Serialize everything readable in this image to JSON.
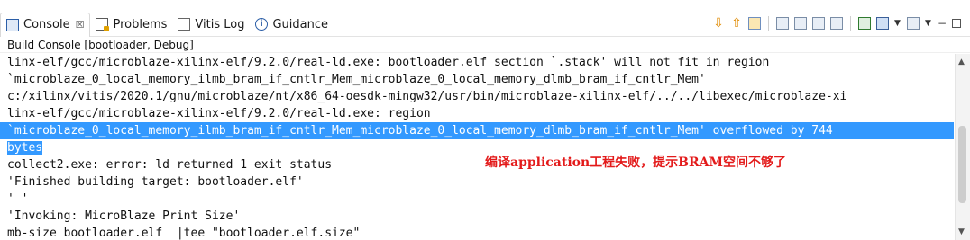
{
  "tabs": [
    {
      "label": "Console",
      "close": "☒",
      "icon": "console-icon"
    },
    {
      "label": "Problems",
      "icon": "problems-icon"
    },
    {
      "label": "Vitis Log",
      "icon": "log-icon"
    },
    {
      "label": "Guidance",
      "icon": "info-icon"
    }
  ],
  "subheader": "Build Console [bootloader, Debug]",
  "lines": [
    "linx-elf/gcc/microblaze-xilinx-elf/9.2.0/real-ld.exe: bootloader.elf section `.stack' will not fit in region",
    "`microblaze_0_local_memory_ilmb_bram_if_cntlr_Mem_microblaze_0_local_memory_dlmb_bram_if_cntlr_Mem'",
    "c:/xilinx/vitis/2020.1/gnu/microblaze/nt/x86_64-oesdk-mingw32/usr/bin/microblaze-xilinx-elf/../../libexec/microblaze-xi",
    "linx-elf/gcc/microblaze-xilinx-elf/9.2.0/real-ld.exe: region",
    "`microblaze_0_local_memory_ilmb_bram_if_cntlr_Mem_microblaze_0_local_memory_dlmb_bram_if_cntlr_Mem' overflowed by 744",
    "bytes",
    "collect2.exe: error: ld returned 1 exit status",
    "'Finished building target: bootloader.elf'",
    "' '",
    "'Invoking: MicroBlaze Print Size'",
    "mb-size bootloader.elf  |tee \"bootloader.elf.size\""
  ],
  "annotation": "编译application工程失败，提示BRAM空间不够了",
  "colors": {
    "selection": "#3399ff",
    "annotation": "#e31a1a"
  }
}
